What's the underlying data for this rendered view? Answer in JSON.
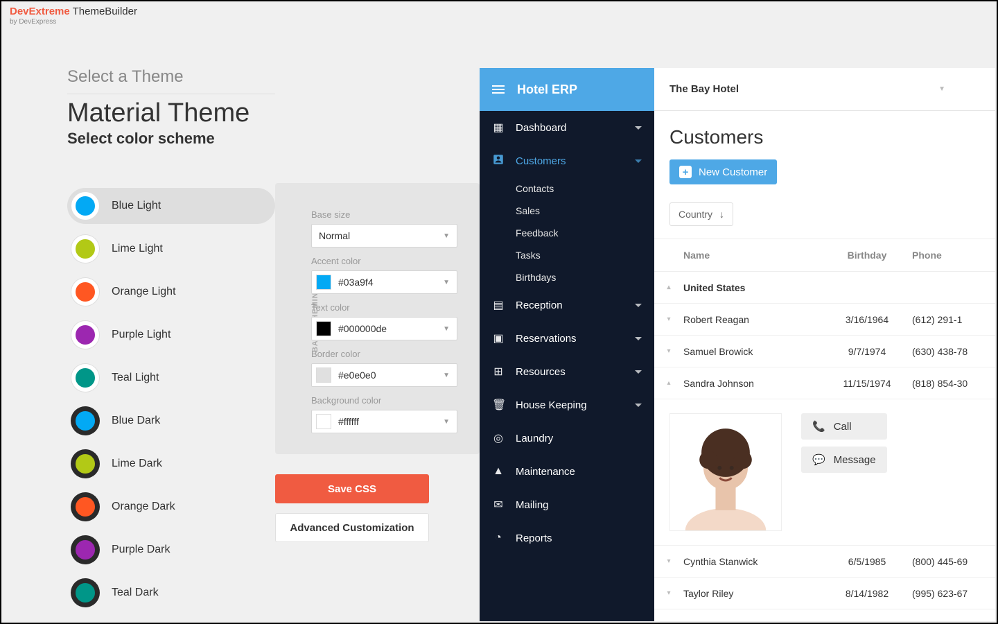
{
  "brand": {
    "name1": "DevExtreme",
    "name2": " ThemeBuilder",
    "by": "by DevExpress"
  },
  "left": {
    "step": "Select a Theme",
    "title": "Material Theme",
    "subtitle": "Select color scheme",
    "schemes": [
      {
        "label": "Blue Light",
        "color": "#03a9f4",
        "dark": false,
        "selected": true
      },
      {
        "label": "Lime Light",
        "color": "#b2c916",
        "dark": false
      },
      {
        "label": "Orange Light",
        "color": "#ff5722",
        "dark": false
      },
      {
        "label": "Purple Light",
        "color": "#9c27b0",
        "dark": false
      },
      {
        "label": "Teal Light",
        "color": "#009688",
        "dark": false
      },
      {
        "label": "Blue Dark",
        "color": "#03a9f4",
        "dark": true
      },
      {
        "label": "Lime Dark",
        "color": "#b2c916",
        "dark": true
      },
      {
        "label": "Orange Dark",
        "color": "#ff5722",
        "dark": true
      },
      {
        "label": "Purple Dark",
        "color": "#9c27b0",
        "dark": true
      },
      {
        "label": "Teal Dark",
        "color": "#009688",
        "dark": true
      }
    ]
  },
  "mid": {
    "section": "BASE THEMING",
    "base_size_label": "Base size",
    "base_size_value": "Normal",
    "accent_label": "Accent color",
    "accent_value": "#03a9f4",
    "text_label": "Text color",
    "text_value": "#000000de",
    "text_chip": "#000000",
    "border_label": "Border color",
    "border_value": "#e0e0e0",
    "bg_label": "Background color",
    "bg_value": "#ffffff"
  },
  "buttons": {
    "save": "Save CSS",
    "adv": "Advanced Customization"
  },
  "preview": {
    "app_title": "Hotel ERP",
    "hotel": "The Bay Hotel",
    "nav": {
      "dashboard": "Dashboard",
      "customers": "Customers",
      "customers_sub": [
        "Contacts",
        "Sales",
        "Feedback",
        "Tasks",
        "Birthdays"
      ],
      "reception": "Reception",
      "reservations": "Reservations",
      "resources": "Resources",
      "housekeeping": "House Keeping",
      "laundry": "Laundry",
      "maintenance": "Maintenance",
      "mailing": "Mailing",
      "reports": "Reports"
    },
    "page_title": "Customers",
    "new_btn": "New Customer",
    "country_chip": "Country",
    "columns": {
      "name": "Name",
      "birthday": "Birthday",
      "phone": "Phone"
    },
    "group": "United States",
    "rows": [
      {
        "name": "Robert Reagan",
        "birthday": "3/16/1964",
        "phone": "(612) 291-1"
      },
      {
        "name": "Samuel Browick",
        "birthday": "9/7/1974",
        "phone": "(630) 438-78"
      },
      {
        "name": "Sandra Johnson",
        "birthday": "11/15/1974",
        "phone": "(818) 854-30",
        "expanded": true
      },
      {
        "name": "Cynthia Stanwick",
        "birthday": "6/5/1985",
        "phone": "(800) 445-69"
      },
      {
        "name": "Taylor Riley",
        "birthday": "8/14/1982",
        "phone": "(995) 623-67"
      }
    ],
    "actions": {
      "call": "Call",
      "message": "Message"
    }
  }
}
